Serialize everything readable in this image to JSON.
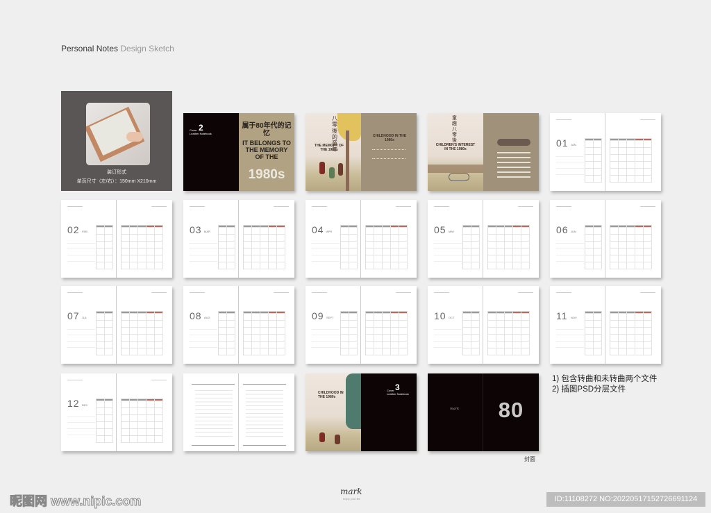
{
  "header": {
    "title_bold": "Personal Notes",
    "title_light": "Design Sketch"
  },
  "binding": {
    "label": "装订形式",
    "size": "单页尺寸（左/右）：150mm X210mm"
  },
  "cover2": {
    "word": "Cover",
    "number": "2",
    "sub": "Leather Notebook",
    "cn": "属于80年代的记忆",
    "en": "IT BELONGS TO THE MEMORY OF THE",
    "year": "1980s"
  },
  "cover1": {
    "cn": "八零後的童年",
    "en": "THE MEMORY OF THE 1980s",
    "back": "CHILDHOOD IN THE 1980s"
  },
  "cover4": {
    "cn": "童趣八零後",
    "en": "CHILDREN'S INTEREST IN THE 1980s"
  },
  "cover3": {
    "title": "CHILDHOOD IN THE 1980s",
    "word": "Cover",
    "number": "3",
    "sub": "Leather Notebook"
  },
  "cover_dark": {
    "big": "80",
    "caption": "封面",
    "logo": "mark"
  },
  "months": [
    {
      "num": "01",
      "name": "JAN"
    },
    {
      "num": "02",
      "name": "FEB"
    },
    {
      "num": "03",
      "name": "MAR"
    },
    {
      "num": "04",
      "name": "APR"
    },
    {
      "num": "05",
      "name": "MAY"
    },
    {
      "num": "06",
      "name": "JUN"
    },
    {
      "num": "07",
      "name": "JUL"
    },
    {
      "num": "08",
      "name": "AUG"
    },
    {
      "num": "09",
      "name": "SEPT"
    },
    {
      "num": "10",
      "name": "OCT"
    },
    {
      "num": "11",
      "name": "NOV"
    },
    {
      "num": "12",
      "name": "DEC"
    }
  ],
  "notes": {
    "line1": "1) 包含转曲和未转曲两个文件",
    "line2": "2) 插图PSD分层文件"
  },
  "footer": {
    "watermark": "昵图网 www.nipic.com",
    "logo": "mark",
    "logo_sub": "enjoy your life",
    "id": "ID:11108272 NO:20220517152726691124"
  },
  "colors": {
    "accent_red": "#b86a5c",
    "dark": "#0d0406",
    "tan": "#b0a283"
  }
}
